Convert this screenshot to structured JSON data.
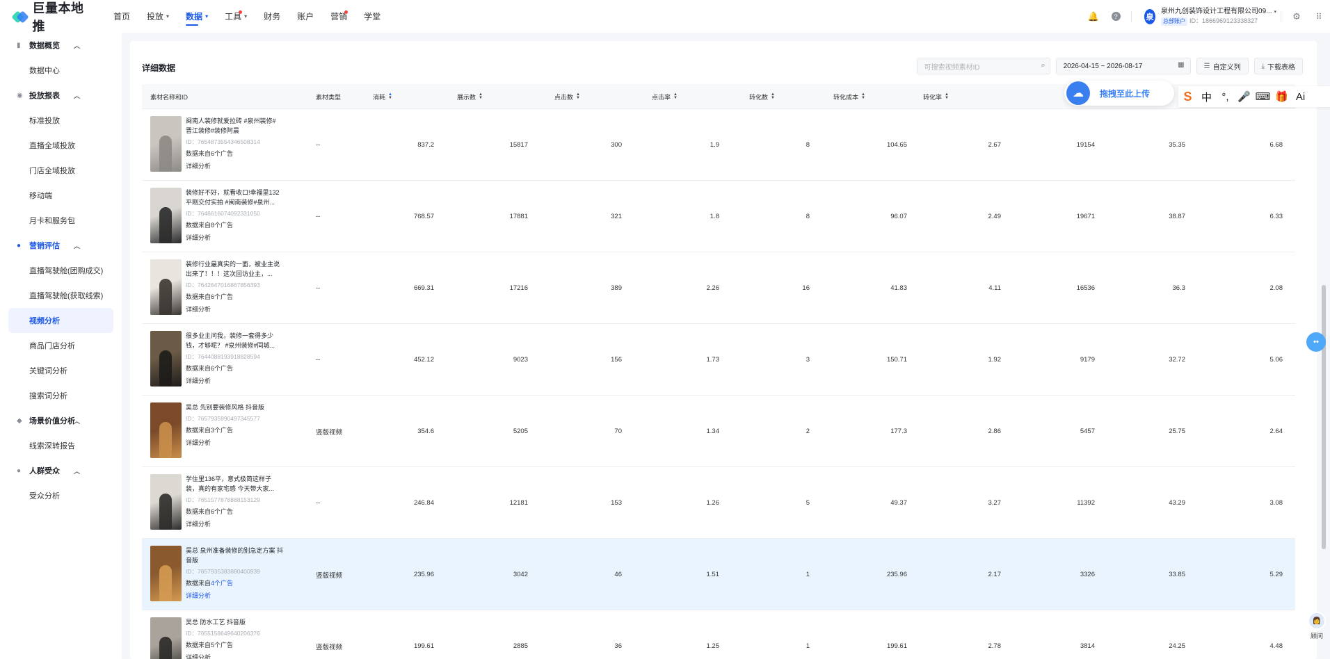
{
  "brand": {
    "name": "巨量本地推"
  },
  "nav": [
    {
      "label": "首页",
      "caret": false,
      "dot": false,
      "active": false
    },
    {
      "label": "投放",
      "caret": true,
      "dot": false,
      "active": false
    },
    {
      "label": "数据",
      "caret": true,
      "dot": false,
      "active": true
    },
    {
      "label": "工具",
      "caret": true,
      "dot": true,
      "active": false
    },
    {
      "label": "财务",
      "caret": false,
      "dot": false,
      "active": false
    },
    {
      "label": "账户",
      "caret": false,
      "dot": false,
      "active": false
    },
    {
      "label": "营销",
      "caret": false,
      "dot": true,
      "active": false
    },
    {
      "label": "学堂",
      "caret": false,
      "dot": false,
      "active": false
    }
  ],
  "account": {
    "avatar_char": "泉",
    "name": "泉州九创装饰设计工程有限公司09...",
    "badge": "总部账户",
    "id_text": "ID：1866969123338327"
  },
  "sidebar": {
    "groups": [
      {
        "label": "数据概览",
        "icon": "bar-chart-icon",
        "highlight": false,
        "items": [
          {
            "label": "数据中心",
            "active": false
          }
        ]
      },
      {
        "label": "投放报表",
        "icon": "report-icon",
        "highlight": false,
        "items": [
          {
            "label": "标准投放",
            "active": false
          },
          {
            "label": "直播全域投放",
            "active": false
          },
          {
            "label": "门店全域投放",
            "active": false
          },
          {
            "label": "移动端",
            "active": false
          },
          {
            "label": "月卡和服务包",
            "active": false
          }
        ]
      },
      {
        "label": "营销评估",
        "icon": "drop-icon",
        "highlight": true,
        "items": [
          {
            "label": "直播驾驶舱(团购成交)",
            "active": false
          },
          {
            "label": "直播驾驶舱(获取线索)",
            "active": false
          },
          {
            "label": "视频分析",
            "active": true
          },
          {
            "label": "商品门店分析",
            "active": false
          },
          {
            "label": "关键词分析",
            "active": false
          },
          {
            "label": "搜索词分析",
            "active": false
          }
        ]
      },
      {
        "label": "场景价值分析",
        "icon": "diamond-icon",
        "highlight": false,
        "items": [
          {
            "label": "线索深转报告",
            "active": false
          }
        ]
      },
      {
        "label": "人群受众",
        "icon": "people-icon",
        "highlight": false,
        "items": [
          {
            "label": "受众分析",
            "active": false
          }
        ]
      }
    ]
  },
  "section": {
    "title": "详细数据"
  },
  "toolbar": {
    "search_placeholder": "可搜索视频素材ID",
    "date_range": "2026-04-15 ~ 2026-08-17",
    "custom_columns": "自定义列",
    "download": "下载表格"
  },
  "table": {
    "columns": [
      "素材名称和ID",
      "素材类型",
      "消耗",
      "展示数",
      "点击数",
      "点击率",
      "转化数",
      "转化成本",
      "转化率"
    ],
    "rows": [
      {
        "title": "闽南人装修就爱拉砖 #泉州装修# 晋江装修#装修阿晨",
        "id": "ID：7654873554346508314",
        "src_prefix": "数据来自",
        "src_count": "6个广告",
        "detail": "详细分析",
        "type": "--",
        "values": [
          "837.2",
          "15817",
          "300",
          "1.9",
          "8",
          "104.65",
          "2.67",
          "19154",
          "35.35",
          "6.68"
        ],
        "thumb_colors": [
          "#c9c6c0",
          "#8d8a86"
        ]
      },
      {
        "title": "装修好不好，就看收口!幸福里132平刚交付实拍 #闽南装修#泉州...",
        "id": "ID：7648616074092331050",
        "src_prefix": "数据来自",
        "src_count": "8个广告",
        "detail": "详细分析",
        "type": "--",
        "values": [
          "768.57",
          "17881",
          "321",
          "1.8",
          "8",
          "96.07",
          "2.49",
          "19671",
          "38.87",
          "6.33"
        ],
        "thumb_colors": [
          "#d9d6d1",
          "#2a2a2a"
        ]
      },
      {
        "title": "装修行业最真实的一面，被业主说出来了！！！这次回访业主，...",
        "id": "ID：7642647016867856393",
        "src_prefix": "数据来自",
        "src_count": "6个广告",
        "detail": "详细分析",
        "type": "--",
        "values": [
          "669.31",
          "17216",
          "389",
          "2.26",
          "16",
          "41.83",
          "4.11",
          "16536",
          "36.3",
          "2.08"
        ],
        "thumb_colors": [
          "#e8e4de",
          "#3a3632"
        ]
      },
      {
        "title": "很多业主问我，装修一套得多少钱，才够呢？ #泉州装修#同城...",
        "id": "ID：7644088193918828594",
        "src_prefix": "数据来自",
        "src_count": "6个广告",
        "detail": "详细分析",
        "type": "--",
        "values": [
          "452.12",
          "9023",
          "156",
          "1.73",
          "3",
          "150.71",
          "1.92",
          "9179",
          "32.72",
          "5.06"
        ],
        "thumb_colors": [
          "#6a5a46",
          "#1d1c1a"
        ]
      },
      {
        "title": "吴总 先别要装修风格 抖音版",
        "id": "ID：7657935990497345577",
        "src_prefix": "数据来自",
        "src_count": "3个广告",
        "detail": "详细分析",
        "type": "竖版视频",
        "values": [
          "354.6",
          "5205",
          "70",
          "1.34",
          "2",
          "177.3",
          "2.86",
          "5457",
          "25.75",
          "2.64"
        ],
        "thumb_colors": [
          "#7a4a2a",
          "#c98e4a"
        ]
      },
      {
        "title": "学住里136平，意式极简这样子装，真的有家宅感 今天带大家...",
        "id": "ID：7651577878888153129",
        "src_prefix": "数据来自",
        "src_count": "6个广告",
        "detail": "详细分析",
        "type": "--",
        "values": [
          "246.84",
          "12181",
          "153",
          "1.26",
          "5",
          "49.37",
          "3.27",
          "11392",
          "43.29",
          "3.08"
        ],
        "thumb_colors": [
          "#dcd8d2",
          "#2e2c2a"
        ]
      },
      {
        "title": "吴总 泉州准备装修的别急定方案 抖音版",
        "id": "ID：7657935383880400939",
        "src_prefix": "数据来自",
        "src_count": "4个广告",
        "detail": "详细分析",
        "type": "竖版视频",
        "values": [
          "235.96",
          "3042",
          "46",
          "1.51",
          "1",
          "235.96",
          "2.17",
          "3326",
          "33.85",
          "5.29"
        ],
        "thumb_colors": [
          "#8a5a2e",
          "#d49a52"
        ]
      },
      {
        "title": "吴总 防水工艺 抖音版",
        "id": "ID：7655158649640206376",
        "src_prefix": "数据来自",
        "src_count": "5个广告",
        "detail": "详细分析",
        "type": "竖版视频",
        "values": [
          "199.61",
          "2885",
          "36",
          "1.25",
          "1",
          "199.61",
          "2.78",
          "3814",
          "24.25",
          "4.48"
        ],
        "thumb_colors": [
          "#a9a39b",
          "#2b2a28"
        ]
      }
    ]
  },
  "overlays": {
    "upload_label": "拖拽至此上传",
    "ime_glyphs": [
      "S",
      "中",
      "°,",
      "🎤",
      "⌨",
      "🎁",
      "Ai"
    ],
    "advisor_label": "顾问"
  }
}
